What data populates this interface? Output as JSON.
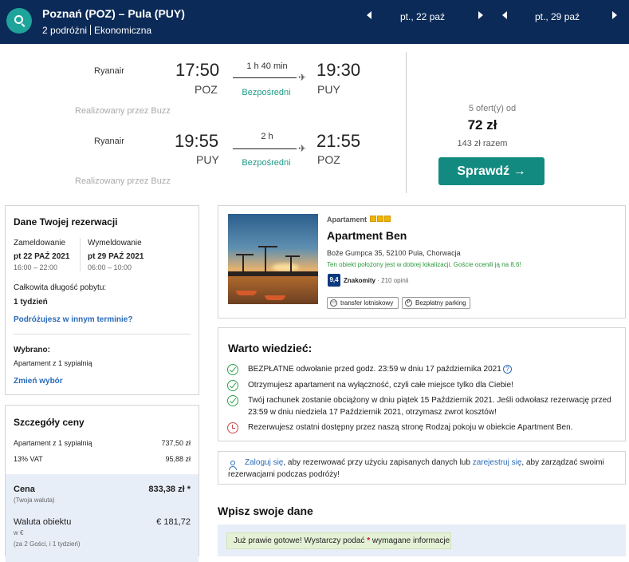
{
  "header": {
    "route": "Poznań (POZ) – Pula (PUY)",
    "travelers": "2 podróżni",
    "cabin": "Ekonomiczna",
    "depart_date": "pt., 22 paź",
    "return_date": "pt., 29 paź"
  },
  "flights": [
    {
      "airline": "Ryanair",
      "dep_time": "17:50",
      "dep_code": "POZ",
      "duration": "1 h 40 min",
      "stops": "Bezpośredni",
      "arr_time": "19:30",
      "arr_code": "PUY",
      "operated_by": "Realizowany przez Buzz"
    },
    {
      "airline": "Ryanair",
      "dep_time": "19:55",
      "dep_code": "PUY",
      "duration": "2 h",
      "stops": "Bezpośredni",
      "arr_time": "21:55",
      "arr_code": "POZ",
      "operated_by": "Realizowany przez Buzz"
    }
  ],
  "price_box": {
    "offers": "5 ofert(y) od",
    "price": "72 zł",
    "total": "143 zł razem",
    "button": "Sprawdź →"
  },
  "booking": {
    "title": "Dane Twojej rezerwacji",
    "checkin_label": "Zameldowanie",
    "checkin_date": "pt 22 PAŹ 2021",
    "checkin_time": "16:00 – 22:00",
    "checkout_label": "Wymeldowanie",
    "checkout_date": "pt 29 PAŹ 2021",
    "checkout_time": "06:00 – 10:00",
    "stay_label": "Całkowita długość pobytu:",
    "stay_value": "1 tydzień",
    "other_dates_link": "Podróżujesz w innym terminie?",
    "selected_label": "Wybrano:",
    "selected_value": "Apartament z 1 sypialnią",
    "change_link": "Zmień wybór"
  },
  "price_details": {
    "title": "Szczegóły ceny",
    "rows": [
      {
        "label": "Apartament z 1 sypialnią",
        "value": "737,50 zł"
      },
      {
        "label": "13% VAT",
        "value": "95,88 zł"
      }
    ],
    "total_label": "Cena",
    "total_sub": "(Twoja waluta)",
    "total_value": "833,38 zł *",
    "local_label": "Waluta obiektu",
    "local_sub1": "w €",
    "local_sub2": "(za 2 Gości,   i 1 tydzień)",
    "local_value": "€ 181,72"
  },
  "hotel": {
    "type": "Apartament",
    "name": "Apartment Ben",
    "address": "Bože Gumpca 35, 52100 Pula, Chorwacja",
    "location_note": "Ten obiekt położony jest w dobrej lokalizacji. Goście ocenili ją na 8,6!",
    "score": "9,4",
    "score_word": "Znakomity",
    "reviews": "· 210 opinii",
    "amenities": [
      "transfer lotniskowy",
      "Bezpłatny parking"
    ]
  },
  "info": {
    "title": "Warto wiedzieć:",
    "items": [
      "BEZPŁATNE odwołanie przed godz. 23:59 w dniu 17 października 2021",
      "Otrzymujesz apartament na wyłączność, czyli całe miejsce tylko dla Ciebie!",
      "Twój rachunek zostanie obciążony w dniu piątek 15 Październik 2021. Jeśli odwołasz rezerwację przed",
      "23:59 w dniu niedziela 17 Październik 2021, otrzymasz zwrot kosztów!",
      "Rezerwujesz ostatni dostępny przez naszą stronę Rodzaj pokoju w obiekcie Apartment Ben."
    ]
  },
  "login": {
    "login_link": "Zaloguj się",
    "mid": ", aby rezerwować przy użyciu zapisanych danych lub ",
    "register_link": "zarejestruj się",
    "end1": ", aby zarządzać swoimi",
    "end2": "rezerwacjami podczas podróży!"
  },
  "form": {
    "title": "Wpisz swoje dane",
    "hint_start": "Już prawie gotowe! Wystarczy podać ",
    "hint_star": "*",
    "hint_end": " wymagane informacje"
  }
}
